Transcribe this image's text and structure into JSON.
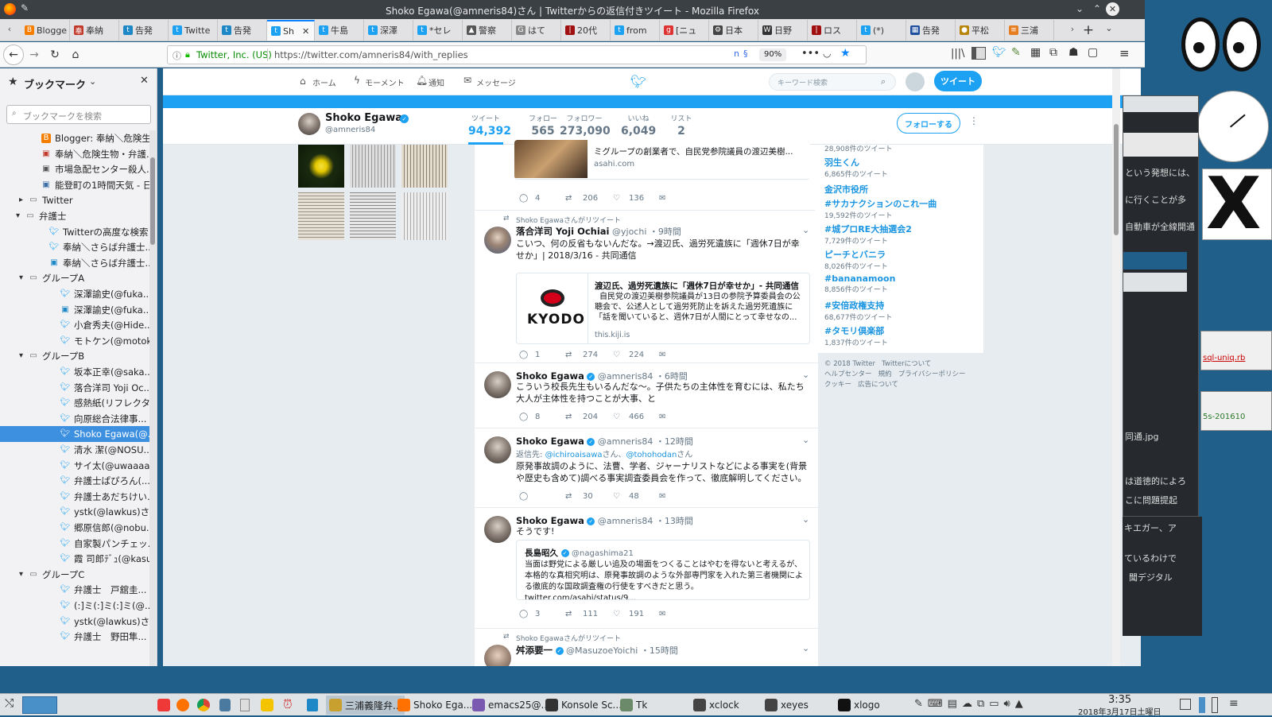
{
  "window": {
    "title": "Shoko Egawa(@amneris84)さん | Twitterからの返信付きツイート - Mozilla Firefox"
  },
  "tabs": [
    {
      "label": "Blogge",
      "color": "#f57d00",
      "glyph": "B"
    },
    {
      "label": "奉納",
      "color": "#c0392b",
      "glyph": "奉"
    },
    {
      "label": "告発",
      "color": "#1e88c7",
      "glyph": "t"
    },
    {
      "label": "Twitte",
      "color": "#1da1f2",
      "glyph": "t"
    },
    {
      "label": "告発",
      "color": "#1e88c7",
      "glyph": "t"
    },
    {
      "label": "Sh",
      "color": "#1da1f2",
      "glyph": "t"
    },
    {
      "label": "牛島",
      "color": "#1da1f2",
      "glyph": "t"
    },
    {
      "label": "深澤",
      "color": "#1da1f2",
      "glyph": "t"
    },
    {
      "label": "*セレ",
      "color": "#1da1f2",
      "glyph": "t"
    },
    {
      "label": "警察",
      "color": "#555",
      "glyph": "▲"
    },
    {
      "label": "はて",
      "color": "#888",
      "glyph": "G"
    },
    {
      "label": "20代",
      "color": "#a01010",
      "glyph": "|"
    },
    {
      "label": "from",
      "color": "#1da1f2",
      "glyph": "t"
    },
    {
      "label": "[ニュ",
      "color": "#d33",
      "glyph": "g"
    },
    {
      "label": "日本",
      "color": "#444",
      "glyph": "⚙"
    },
    {
      "label": "日野",
      "color": "#333",
      "glyph": "W"
    },
    {
      "label": "ロス",
      "color": "#a01010",
      "glyph": "|"
    },
    {
      "label": "(*)",
      "color": "#1da1f2",
      "glyph": "t"
    },
    {
      "label": "告発",
      "color": "#1e4f9e",
      "glyph": "▦"
    },
    {
      "label": "平松",
      "color": "#b8860b",
      "glyph": "●"
    },
    {
      "label": "三浦",
      "color": "#e67e22",
      "glyph": "≡"
    }
  ],
  "navbar": {
    "identity": "Twitter, Inc. (US)",
    "url": "https://twitter.com/amneris84/with_replies",
    "zoom": "90%"
  },
  "sidebar": {
    "title": "ブックマーク",
    "search_placeholder": "ブックマークを検索",
    "items": [
      {
        "label": "Blogger: 奉納＼危険生...",
        "indent": 2,
        "icon": "blogger",
        "color": "#f57d00"
      },
      {
        "label": "奉納＼危険生物・弁護...",
        "indent": 2,
        "icon": "page",
        "color": "#c0392b"
      },
      {
        "label": "市場急配センター殺人...",
        "indent": 2,
        "icon": "page",
        "color": "#555"
      },
      {
        "label": "能登町の1時間天気 - 日...",
        "indent": 2,
        "icon": "page",
        "color": "#3a6ea5"
      },
      {
        "label": "Twitter",
        "indent": 1,
        "icon": "folder-closed",
        "color": "#666"
      },
      {
        "label": "弁護士",
        "indent": 0,
        "icon": "folder-open",
        "color": "#666"
      },
      {
        "label": "Twitterの高度な検索",
        "indent": 3,
        "icon": "bird",
        "color": "#1da1f2"
      },
      {
        "label": "奉納＼さらば弁護士...",
        "indent": 3,
        "icon": "bird",
        "color": "#1da1f2"
      },
      {
        "label": "奉納＼さらば弁護士...",
        "indent": 3,
        "icon": "page",
        "color": "#1e88c7"
      },
      {
        "label": "グループA",
        "indent": 1,
        "icon": "folder-open",
        "color": "#666"
      },
      {
        "label": "深澤諭史(@fuka...",
        "indent": 4,
        "icon": "bird",
        "color": "#1da1f2"
      },
      {
        "label": "深澤諭史(@fuka...",
        "indent": 4,
        "icon": "page",
        "color": "#1e88c7"
      },
      {
        "label": "小倉秀夫(@Hide...",
        "indent": 4,
        "icon": "bird",
        "color": "#1da1f2"
      },
      {
        "label": "モトケン(@motok...",
        "indent": 4,
        "icon": "bird",
        "color": "#1da1f2"
      },
      {
        "label": "グループB",
        "indent": 1,
        "icon": "folder-open",
        "color": "#666"
      },
      {
        "label": "坂本正幸(@saka...",
        "indent": 4,
        "icon": "bird",
        "color": "#1da1f2"
      },
      {
        "label": "落合洋司 Yoji Oc...",
        "indent": 4,
        "icon": "bird",
        "color": "#1da1f2"
      },
      {
        "label": "感熱紙(リフレクタ...",
        "indent": 4,
        "icon": "bird",
        "color": "#1da1f2"
      },
      {
        "label": "向原総合法律事...",
        "indent": 4,
        "icon": "bird",
        "color": "#1da1f2"
      },
      {
        "label": "Shoko Egawa(@...",
        "indent": 4,
        "icon": "bird",
        "color": "#1da1f2",
        "selected": true
      },
      {
        "label": "清水 潔(@NOSU...",
        "indent": 4,
        "icon": "bird",
        "color": "#1da1f2"
      },
      {
        "label": "サイ太(@uwaaaa...",
        "indent": 4,
        "icon": "bird",
        "color": "#1da1f2"
      },
      {
        "label": "弁護士ぱぴろん(...",
        "indent": 4,
        "icon": "bird",
        "color": "#1da1f2"
      },
      {
        "label": "弁護士あだちけい...",
        "indent": 4,
        "icon": "bird",
        "color": "#1da1f2"
      },
      {
        "label": "ystk(@lawkus)さ...",
        "indent": 4,
        "icon": "bird",
        "color": "#1da1f2"
      },
      {
        "label": "郷原信郎(@nobu...",
        "indent": 4,
        "icon": "bird",
        "color": "#1da1f2"
      },
      {
        "label": "自家製パンチェッ...",
        "indent": 4,
        "icon": "bird",
        "color": "#1da1f2"
      },
      {
        "label": "霞 司郎ﾃﾞｭ(@kasu...",
        "indent": 4,
        "icon": "bird",
        "color": "#1da1f2"
      },
      {
        "label": "グループC",
        "indent": 1,
        "icon": "folder-open",
        "color": "#666"
      },
      {
        "label": "弁護士　戸舘圭...",
        "indent": 4,
        "icon": "bird",
        "color": "#1da1f2"
      },
      {
        "label": "(:]ミ(:]ミ(:]ミ(@...",
        "indent": 4,
        "icon": "bird",
        "color": "#1da1f2"
      },
      {
        "label": "ystk(@lawkus)さ...",
        "indent": 4,
        "icon": "bird",
        "color": "#1da1f2"
      },
      {
        "label": "弁護士　野田隼...",
        "indent": 4,
        "icon": "bird",
        "color": "#1da1f2"
      }
    ]
  },
  "twitter_nav": {
    "home": "ホーム",
    "moments": "モーメント",
    "notifications": "通知",
    "messages": "メッセージ",
    "search_placeholder": "キーワード検索",
    "tweet_button": "ツイート"
  },
  "profile": {
    "name": "Shoko Egawa",
    "handle": "@amneris84",
    "stats": [
      {
        "label": "ツイート",
        "value": "94,392",
        "active": true
      },
      {
        "label": "フォロー",
        "value": "565"
      },
      {
        "label": "フォロワー",
        "value": "273,090"
      },
      {
        "label": "いいね",
        "value": "6,049"
      },
      {
        "label": "リスト",
        "value": "2"
      }
    ],
    "follow_button": "フォローする"
  },
  "tweets": {
    "t0": {
      "card_text": "ミグループの創業者で、自民党参院議員の渡辺美樹...",
      "card_domain": "asahi.com",
      "reply": "4",
      "retweet": "206",
      "like": "136"
    },
    "t1": {
      "retweet_note": "Shoko Egawaさんがリツイート",
      "name": "落合洋司 Yoji Ochiai",
      "handle": "@yjochi",
      "time": "・9時間",
      "text": "こいつ、何の反省もないんだな。→渡辺氏、過労死遺族に「週休7日が幸せか」| 2018/3/16 - 共同通信",
      "card_title": "渡辺氏、過労死遺族に「週休7日が幸せか」- 共同通信",
      "card_desc": "自民党の渡辺美樹参院議員が13日の参院予算委員会の公聴会で、公述人として過労死防止を訴えた過労死遺族に「話を聞いていると、週休7日が人間にとって幸せなの...",
      "card_domain": "this.kiji.is",
      "card_logo": "KYODO",
      "reply": "1",
      "retweet": "274",
      "like": "224"
    },
    "t2": {
      "name": "Shoko Egawa",
      "handle": "@amneris84",
      "time": "・6時間",
      "text": "こういう校長先生もいるんだな〜。子供たちの主体性を育むには、私たち大人が主体性を持つことが大事、と",
      "reply": "8",
      "retweet": "204",
      "like": "466"
    },
    "t3": {
      "name": "Shoko Egawa",
      "handle": "@amneris84",
      "time": "・12時間",
      "reply_to_label": "返信先:",
      "reply_to_1": "@ichiroaisawa",
      "reply_to_mid": "さん、",
      "reply_to_2": "@tohohodan",
      "reply_to_end": "さん",
      "text": "原発事故調のように、法曹、学者、ジャーナリストなどによる事実を(背景や歴史も含めて)調べる事実調査委員会を作って、徹底解明してください。",
      "reply": "",
      "retweet": "30",
      "like": "48"
    },
    "t4": {
      "name": "Shoko Egawa",
      "handle": "@amneris84",
      "time": "・13時間",
      "text": "そうです!",
      "quote_name": "長島昭久",
      "quote_handle": "@nagashima21",
      "quote_text": "当面は野党による厳しい追及の場面をつくることはやむを得ないと考えるが、本格的な真相究明は、原発事故調のような外部専門家を入れた第三者機関による徹底的な国政調査権の行使をすべきだと思う。twitter.com/asahi/status/9...",
      "reply": "3",
      "retweet": "111",
      "like": "191"
    },
    "t5": {
      "retweet_note": "Shoko Egawaさんがリツイート",
      "name": "舛添要一",
      "handle": "@MasuzoeYoichi",
      "time": "・15時間"
    }
  },
  "trends": [
    {
      "name": "",
      "count": "28,908件のツイート"
    },
    {
      "name": "羽生くん",
      "count": "6,865件のツイート"
    },
    {
      "name": "金沢市役所",
      "count": ""
    },
    {
      "name": "#サカナクションのこれ一曲",
      "count": "19,592件のツイート"
    },
    {
      "name": "#城プロRE大抽選会2",
      "count": "7,729件のツイート"
    },
    {
      "name": "ピーチとバニラ",
      "count": "8,026件のツイート"
    },
    {
      "name": "#bananamoon",
      "count": "8,856件のツイート"
    },
    {
      "name": "#安倍政権支持",
      "count": "68,677件のツイート"
    },
    {
      "name": "#タモリ倶楽部",
      "count": "1,837件のツイート"
    }
  ],
  "footer": {
    "line1": "© 2018 Twitter   Twitterについて",
    "line2": "ヘルプセンター   規約   プライバシーポリシー",
    "line3": "クッキー   広告について"
  },
  "desktop_bits": {
    "snippet1": "という発想には、",
    "snippet2": "に行くことが多",
    "snippet3": "自動車が全線開通",
    "file1": "sql-uniq.rb",
    "file2": "5s-201610",
    "file3": "同通.jpg",
    "snippet4": "は道徳的によろ",
    "snippet5": "こに問題提起",
    "snippet6": "キエガー、ア",
    "snippet7": "ているわけで",
    "snippet8": "聞デジタル"
  },
  "taskbar": {
    "tasks": [
      {
        "label": "三浦義隆弁..."
      },
      {
        "label": "Shoko Ega..."
      },
      {
        "label": "emacs25@..."
      },
      {
        "label": "Konsole Sc..."
      },
      {
        "label": "Tk"
      },
      {
        "label": "xclock"
      },
      {
        "label": "xeyes"
      },
      {
        "label": "xlogo"
      }
    ],
    "clock_time": "3:35",
    "clock_date": "2018年3月17日土曜日"
  }
}
